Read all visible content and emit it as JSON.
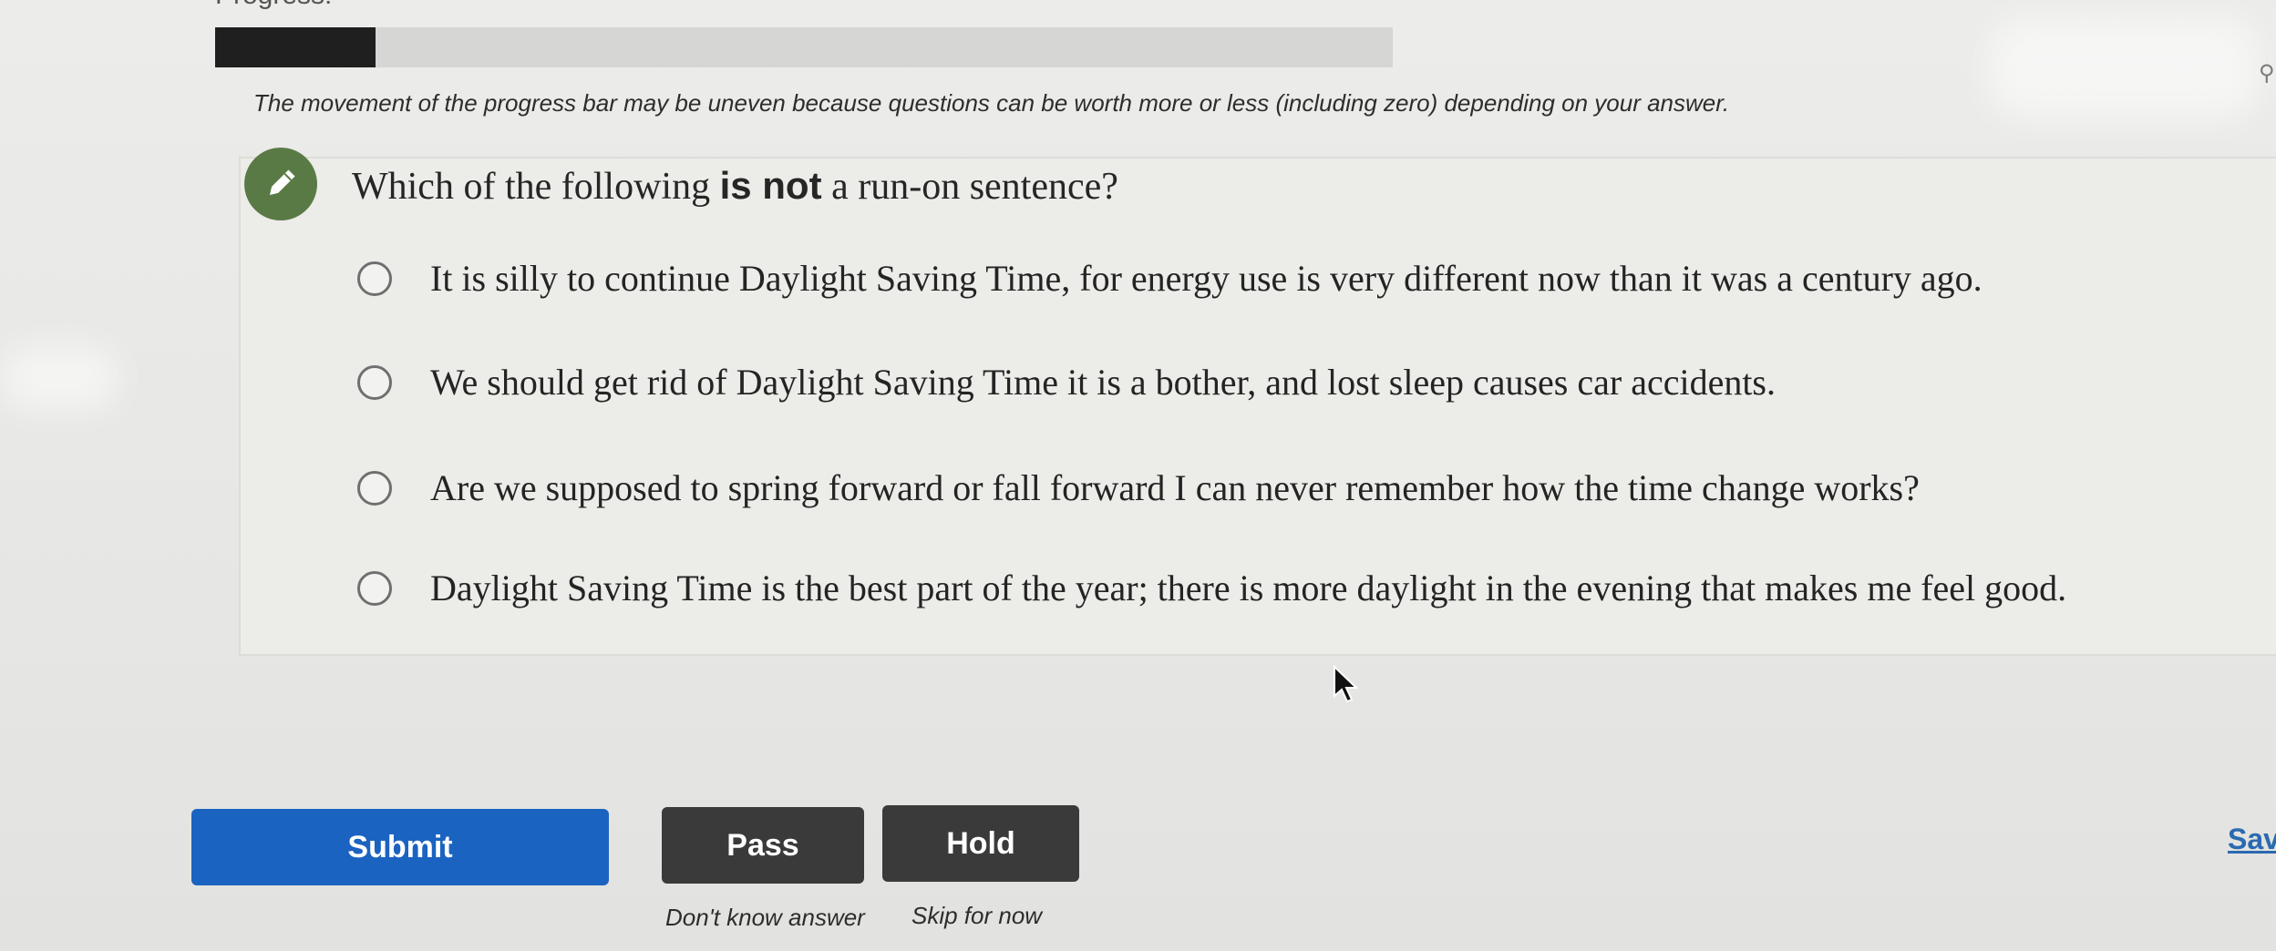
{
  "progress": {
    "label": "Progress:",
    "fraction": 0.136,
    "note": "The movement of the progress bar may be uneven because questions can be worth more or less (including zero) depending on your answer."
  },
  "question": {
    "icon": "pencil-icon",
    "text_before": "Which of the following ",
    "text_emphasis": "is not",
    "text_after": " a run-on sentence?",
    "options": [
      "It is silly to continue Daylight Saving Time, for energy use is very different now than it was a century ago.",
      "We should get rid of Daylight Saving Time it is a bother, and lost sleep causes car accidents.",
      "Are we supposed to spring forward or fall forward I can never remember how the time change works?",
      "Daylight Saving Time is the best part of the year; there is more daylight in the evening that makes me feel good."
    ]
  },
  "actions": {
    "submit_label": "Submit",
    "pass_label": "Pass",
    "pass_hint": "Don't know answer",
    "hold_label": "Hold",
    "hold_hint": "Skip for now",
    "save_label": "Sav"
  },
  "colors": {
    "submit": "#1b63c0",
    "secondary_buttons": "#3a3a3a",
    "badge": "#5a7a45",
    "progress_fill": "#1f1f1f"
  }
}
